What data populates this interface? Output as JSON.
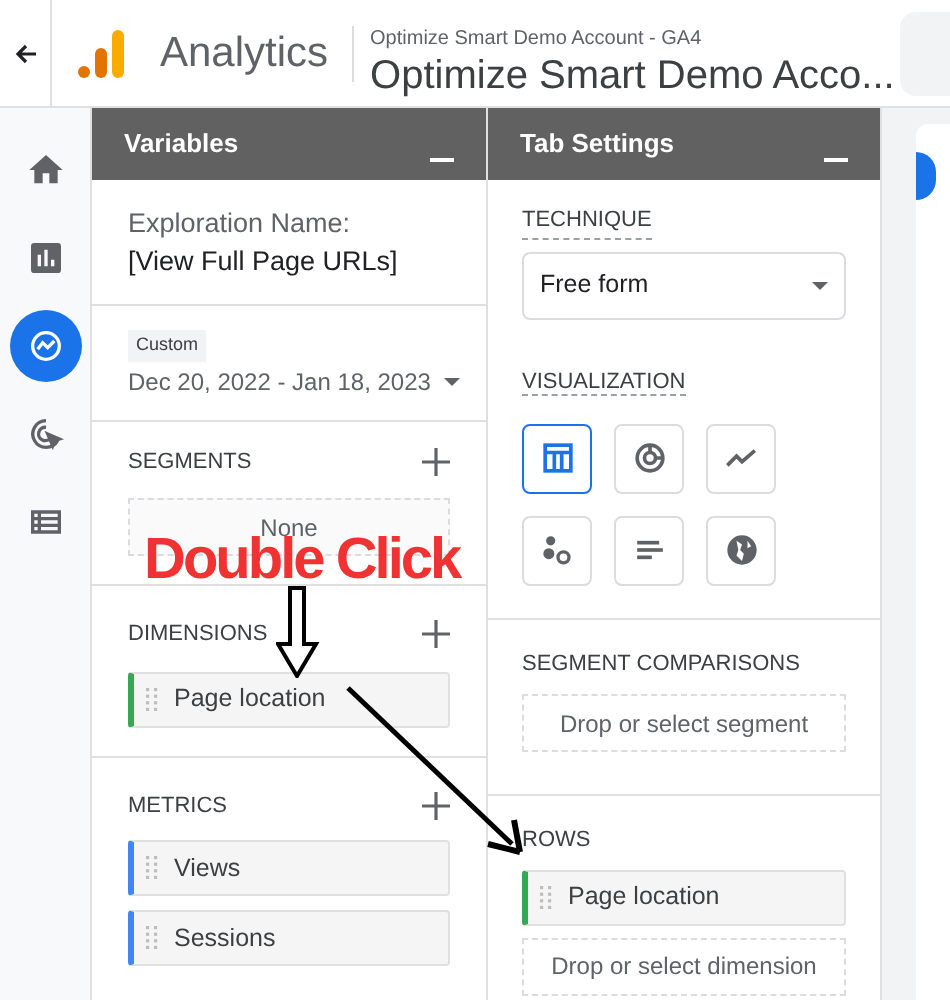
{
  "header": {
    "product": "Analytics",
    "account": "Optimize Smart Demo Account - GA4",
    "property": "Optimize Smart Demo Acco..."
  },
  "nav": [
    {
      "selected": false
    },
    {
      "selected": false
    },
    {
      "selected": true
    },
    {
      "selected": false
    },
    {
      "selected": false
    }
  ],
  "variables": {
    "title": "Variables",
    "exploration_label": "Exploration Name:",
    "exploration_name": "[View Full Page URLs]",
    "date_badge": "Custom",
    "date_range": "Dec 20, 2022 - Jan 18, 2023",
    "segments": {
      "label": "SEGMENTS",
      "items": [
        "None"
      ]
    },
    "dimensions": {
      "label": "DIMENSIONS",
      "items": [
        "Page location"
      ]
    },
    "metrics": {
      "label": "METRICS",
      "items": [
        "Views",
        "Sessions"
      ]
    }
  },
  "tab_settings": {
    "title": "Tab Settings",
    "technique_label": "TECHNIQUE",
    "technique": "Free form",
    "visualization_label": "VISUALIZATION",
    "visualizations": [
      {
        "kind": "table",
        "selected": true
      },
      {
        "kind": "donut",
        "selected": false
      },
      {
        "kind": "line",
        "selected": false
      },
      {
        "kind": "scatter",
        "selected": false
      },
      {
        "kind": "bar",
        "selected": false
      },
      {
        "kind": "geo",
        "selected": false
      }
    ],
    "segment_comparisons_label": "SEGMENT COMPARISONS",
    "segment_drop": "Drop or select segment",
    "rows_label": "ROWS",
    "rows": [
      "Page location"
    ],
    "rows_drop": "Drop or select dimension"
  },
  "annotation": {
    "text": "Double Click"
  }
}
